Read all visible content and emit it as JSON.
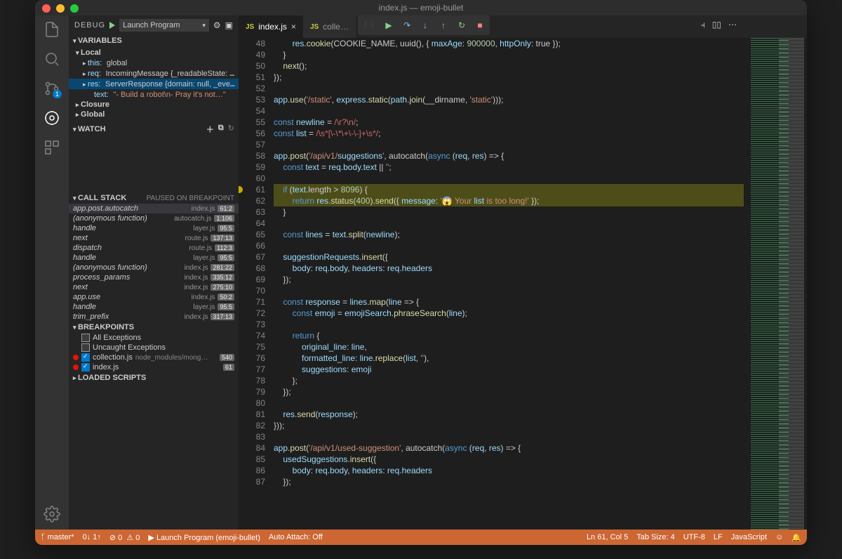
{
  "title": "index.js — emoji-bullet",
  "debug_header": {
    "label": "DEBUG",
    "config": "Launch Program"
  },
  "variables": {
    "title": "VARIABLES",
    "local": "Local",
    "closure": "Closure",
    "global": "Global",
    "rows": [
      {
        "k": "this",
        "v": "global"
      },
      {
        "k": "req",
        "v": "IncomingMessage {_readableState: R…"
      },
      {
        "k": "res",
        "v": "ServerResponse {domain: null, _eve…",
        "sel": true
      },
      {
        "k": "text",
        "v": "\"- Build a robot\\n- Pray it's not…\"",
        "str": true,
        "sub": true
      }
    ]
  },
  "watch": {
    "title": "WATCH"
  },
  "callstack": {
    "title": "CALL STACK",
    "status": "PAUSED ON BREAKPOINT",
    "rows": [
      {
        "fn": "app.post.autocatch",
        "file": "index.js",
        "pos": "61:2"
      },
      {
        "fn": "(anonymous function)",
        "file": "autocatch.js",
        "pos": "1:106"
      },
      {
        "fn": "handle",
        "file": "layer.js",
        "pos": "95:5"
      },
      {
        "fn": "next",
        "file": "route.js",
        "pos": "137:13"
      },
      {
        "fn": "dispatch",
        "file": "route.js",
        "pos": "112:3"
      },
      {
        "fn": "handle",
        "file": "layer.js",
        "pos": "95:5"
      },
      {
        "fn": "(anonymous function)",
        "file": "index.js",
        "pos": "281:22"
      },
      {
        "fn": "process_params",
        "file": "index.js",
        "pos": "335:12"
      },
      {
        "fn": "next",
        "file": "index.js",
        "pos": "275:10"
      },
      {
        "fn": "app.use",
        "file": "index.js",
        "pos": "50:2"
      },
      {
        "fn": "handle",
        "file": "layer.js",
        "pos": "95:5"
      },
      {
        "fn": "trim_prefix",
        "file": "index.js",
        "pos": "317:13"
      }
    ]
  },
  "breakpoints": {
    "title": "BREAKPOINTS",
    "all": "All Exceptions",
    "uncaught": "Uncaught Exceptions",
    "items": [
      {
        "file": "collection.js",
        "path": "node_modules/mong…",
        "line": "540"
      },
      {
        "file": "index.js",
        "path": "",
        "line": "61"
      }
    ]
  },
  "loaded": "LOADED SCRIPTS",
  "tabs": [
    {
      "label": "index.js",
      "active": true
    },
    {
      "label": "colle…",
      "active": false
    }
  ],
  "code_start": 48,
  "code_lines": [
    "        res.cookie(COOKIE_NAME, uuid(), { maxAge: 900000, httpOnly: true });",
    "    }",
    "    next();",
    "});",
    "",
    "app.use('/static', express.static(path.join(__dirname, 'static')));",
    "",
    "const newline = /\\r?\\n/;",
    "const list = /\\s*[\\-\\*\\+\\-\\-]+\\s*/;",
    "",
    "app.post('/api/v1/suggestions', autocatch(async (req, res) => {",
    "    const text = req.body.text || '';",
    "",
    "    if (text.length > 8096) {",
    "        return res.status(400).send({ message: '😱 Your list is too long!' });",
    "    }",
    "",
    "    const lines = text.split(newline);",
    "",
    "    suggestionRequests.insert({",
    "        body: req.body, headers: req.headers",
    "    });",
    "",
    "    const response = lines.map(line => {",
    "        const emoji = emojiSearch.phraseSearch(line);",
    "",
    "        return {",
    "            original_line: line,",
    "            formatted_line: line.replace(list, ''),",
    "            suggestions: emoji",
    "        };",
    "    });",
    "",
    "    res.send(response);",
    "}));",
    "",
    "app.post('/api/v1/used-suggestion', autocatch(async (req, res) => {",
    "    usedSuggestions.insert({",
    "        body: req.body, headers: req.headers",
    "    });"
  ],
  "status": {
    "branch": "master*",
    "sync": "0↓ 1↑",
    "errors": "0",
    "warnings": "0",
    "launch": "Launch Program (emoji-bullet)",
    "attach": "Auto Attach: Off",
    "pos": "Ln 61, Col 5",
    "tab": "Tab Size: 4",
    "enc": "UTF-8",
    "eol": "LF",
    "lang": "JavaScript"
  }
}
